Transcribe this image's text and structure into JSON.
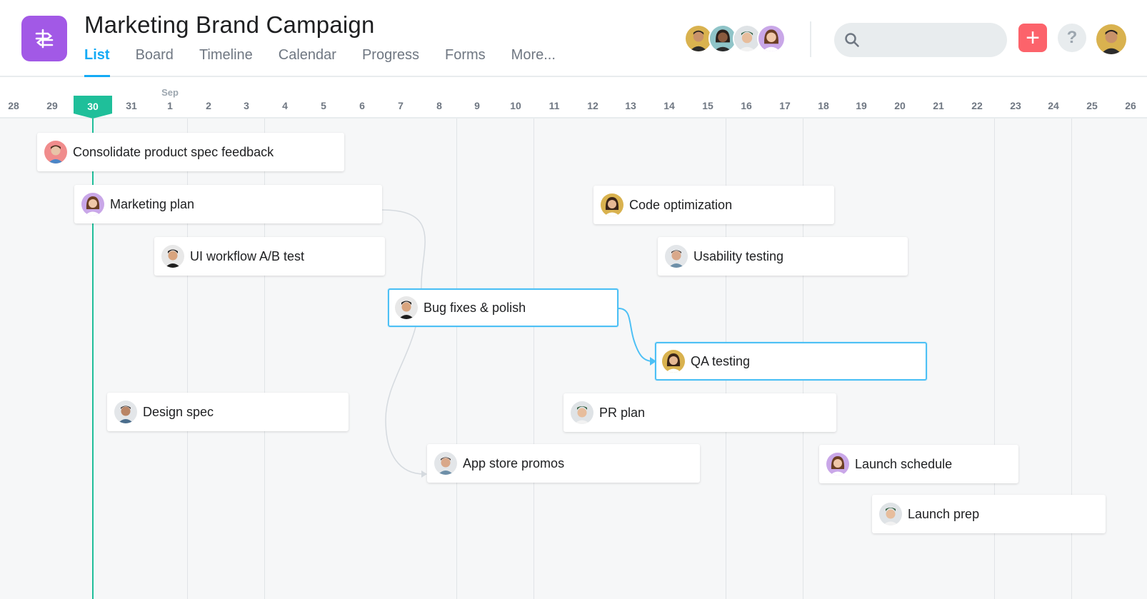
{
  "project": {
    "title": "Marketing Brand Campaign",
    "icon": "timeline-icon",
    "accent_color": "#a259e6"
  },
  "tabs": [
    {
      "label": "List",
      "active": true
    },
    {
      "label": "Board"
    },
    {
      "label": "Timeline"
    },
    {
      "label": "Calendar"
    },
    {
      "label": "Progress"
    },
    {
      "label": "Forms"
    },
    {
      "label": "More..."
    }
  ],
  "members": [
    "member-avatar-1",
    "member-avatar-2",
    "member-avatar-3",
    "member-avatar-4"
  ],
  "search": {
    "placeholder": "",
    "value": ""
  },
  "toolbar": {
    "add_label": "+",
    "help_label": "?"
  },
  "timeline": {
    "month_label": "Sep",
    "today": "30",
    "dates": [
      "28",
      "29",
      "30",
      "31",
      "1",
      "2",
      "3",
      "4",
      "5",
      "6",
      "7",
      "8",
      "9",
      "10",
      "11",
      "12",
      "13",
      "14",
      "15",
      "16",
      "17",
      "18",
      "19",
      "20",
      "21",
      "22",
      "23",
      "24",
      "25",
      "26"
    ],
    "today_color": "#1fbf9a",
    "selection_color": "#4dc0f5"
  },
  "tasks": [
    {
      "name": "Consolidate product spec feedback"
    },
    {
      "name": "Marketing plan"
    },
    {
      "name": "UI workflow A/B test"
    },
    {
      "name": "Bug fixes & polish",
      "selected": true
    },
    {
      "name": "Design spec"
    },
    {
      "name": "App store promos"
    },
    {
      "name": "Code optimization"
    },
    {
      "name": "Usability testing"
    },
    {
      "name": "QA testing",
      "selected": true
    },
    {
      "name": "PR plan"
    },
    {
      "name": "Launch schedule"
    },
    {
      "name": "Launch prep"
    }
  ]
}
